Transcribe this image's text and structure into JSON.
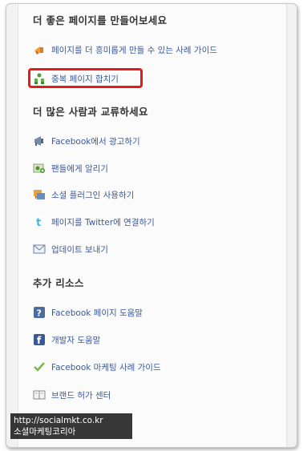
{
  "sections": {
    "better_page": {
      "title": "더 좋은 페이지를 만들어보세요",
      "items": [
        {
          "label": "페이지를 더 흥미롭게 만들 수 있는 사례 가이드",
          "icon": "megaphone-hand-icon"
        },
        {
          "label": "중복 페이지 합치기",
          "icon": "merge-people-icon"
        }
      ]
    },
    "connect": {
      "title": "더 많은 사람과 교류하세요",
      "items": [
        {
          "label": "Facebook에서 광고하기",
          "icon": "megaphone-icon"
        },
        {
          "label": "팬들에게 알리기",
          "icon": "invite-fans-icon"
        },
        {
          "label": "소셜 플러그인 사용하기",
          "icon": "social-plugin-icon"
        },
        {
          "label": "페이지를 Twitter에 연결하기",
          "icon": "twitter-icon"
        },
        {
          "label": "업데이트 보내기",
          "icon": "envelope-icon"
        }
      ]
    },
    "resources": {
      "title": "추가 리소스",
      "items": [
        {
          "label": "Facebook 페이지 도움말",
          "icon": "help-icon"
        },
        {
          "label": "개발자 도움말",
          "icon": "developer-icon"
        },
        {
          "label": "Facebook 마케팅 사례 가이드",
          "icon": "checkmark-icon"
        },
        {
          "label": "브랜드 허가 센터",
          "icon": "book-icon"
        }
      ]
    }
  },
  "watermark": {
    "url": "http://socialmkt.co.kr",
    "name": "소셜마케팅코리아"
  },
  "colors": {
    "link": "#3b5998",
    "highlight": "#e31b1b",
    "heading": "#333333"
  }
}
